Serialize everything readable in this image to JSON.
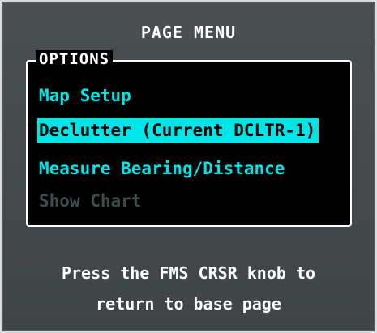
{
  "page_menu": {
    "title": "PAGE MENU",
    "options_label": "OPTIONS",
    "items": [
      {
        "label": "Map Setup",
        "state": "enabled"
      },
      {
        "label": "Declutter (Current DCLTR-1)",
        "state": "selected"
      },
      {
        "label": "Measure Bearing/Distance",
        "state": "enabled"
      },
      {
        "label": "Show Chart",
        "state": "disabled"
      }
    ],
    "footer_line1": "Press the FMS CRSR knob to",
    "footer_line2": "return to base page"
  },
  "colors": {
    "panel_background": "#45494c",
    "list_background": "#000000",
    "item_cyan": "#00e6e6",
    "item_disabled": "#3e4c4c",
    "text_white": "#ffffff"
  }
}
